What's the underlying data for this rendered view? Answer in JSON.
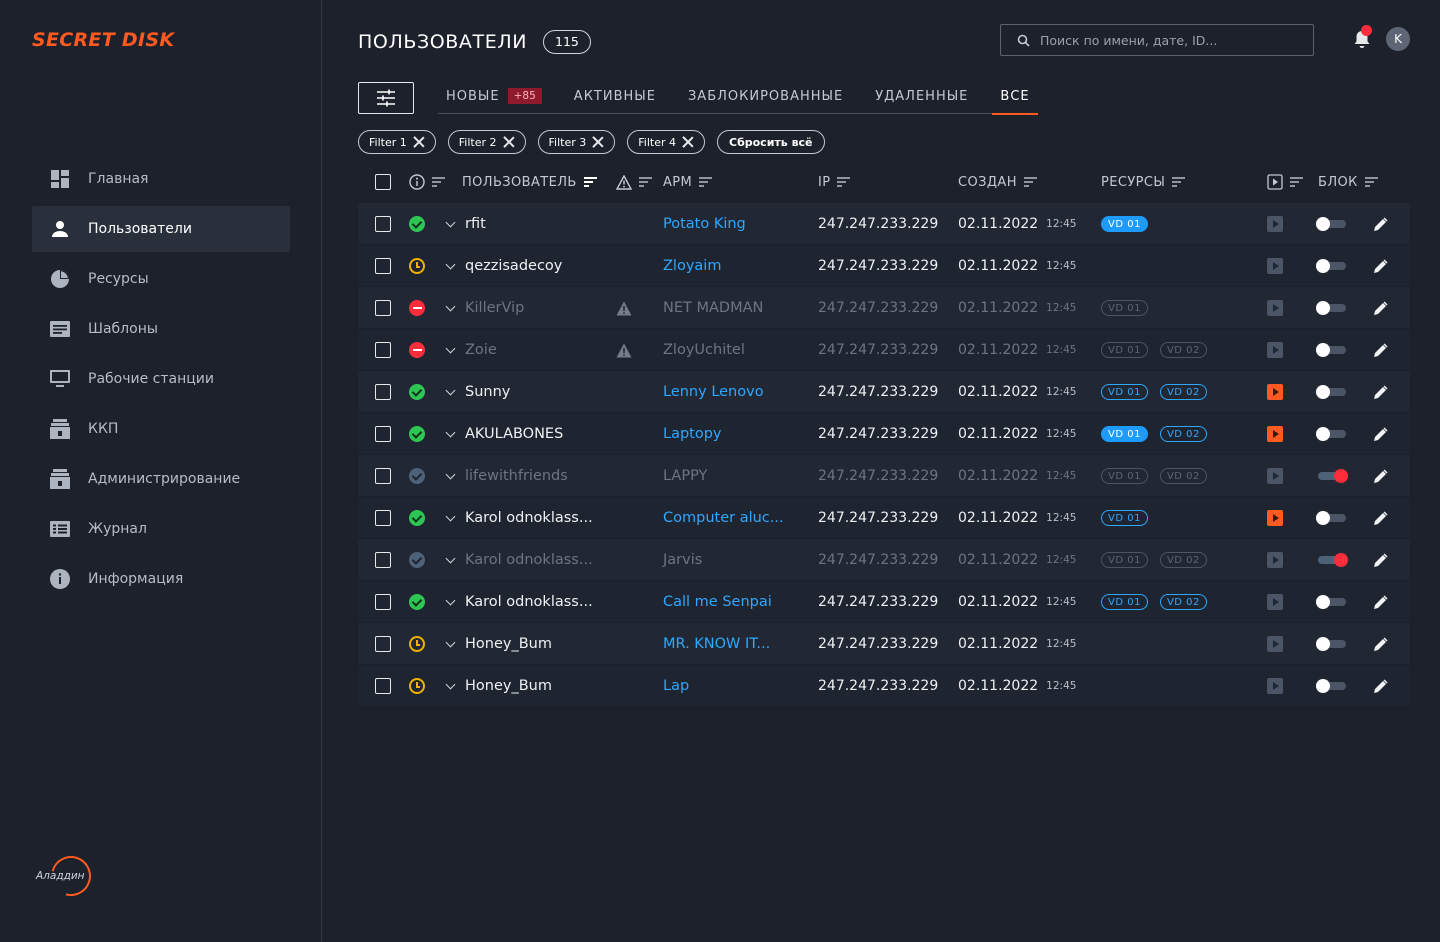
{
  "app": {
    "logo": "SECRET DISK",
    "brand": "Аладдин"
  },
  "sidebar": {
    "items": [
      {
        "label": "Главная",
        "icon": "dashboard-icon",
        "active": false
      },
      {
        "label": "Пользователи",
        "icon": "user-icon",
        "active": true
      },
      {
        "label": "Ресурсы",
        "icon": "pie-chart-icon",
        "active": false
      },
      {
        "label": "Шаблоны",
        "icon": "template-icon",
        "active": false
      },
      {
        "label": "Рабочие станции",
        "icon": "monitor-icon",
        "active": false
      },
      {
        "label": "ККП",
        "icon": "lock-box-icon",
        "active": false
      },
      {
        "label": "Администрирование",
        "icon": "admin-lock-icon",
        "active": false
      },
      {
        "label": "Журнал",
        "icon": "journal-icon",
        "active": false
      },
      {
        "label": "Информация",
        "icon": "info-icon",
        "active": false
      }
    ]
  },
  "header": {
    "title": "ПОЛЬЗОВАТЕЛИ",
    "count": "115",
    "search_placeholder": "Поиск по имени, дате, ID...",
    "avatar_initial": "K"
  },
  "tabs": [
    {
      "label": "НОВЫЕ",
      "badge": "+85",
      "active": false
    },
    {
      "label": "АКТИВНЫЕ",
      "badge": "",
      "active": false
    },
    {
      "label": "ЗАБЛОКИРОВАННЫЕ",
      "badge": "",
      "active": false
    },
    {
      "label": "УДАЛЕННЫЕ",
      "badge": "",
      "active": false
    },
    {
      "label": "ВСЕ",
      "badge": "",
      "active": true
    }
  ],
  "filters": [
    "Filter 1",
    "Filter 2",
    "Filter 3",
    "Filter 4"
  ],
  "reset_label": "Сбросить всё",
  "columns": {
    "user": "ПОЛЬЗОВАТЕЛЬ",
    "arm": "АРМ",
    "ip": "IP",
    "created": "СОЗДАН",
    "resources": "РЕСУРСЫ",
    "block": "БЛОК"
  },
  "colors": {
    "accent": "#ff5a1f",
    "link": "#2ea7ff",
    "ok": "#2dc653",
    "danger": "#ff2d3c",
    "warn": "#f0b100"
  },
  "rows": [
    {
      "status": "ok",
      "name": "rfit",
      "warn": false,
      "arm": "Potato King",
      "ip": "247.247.233.229",
      "date": "02.11.2022",
      "time": "12:45",
      "vd": [
        {
          "label": "VD 01",
          "fill": true
        }
      ],
      "play": false,
      "blocked": false,
      "dim": false
    },
    {
      "status": "wait",
      "name": "qezzisadecoy",
      "warn": false,
      "arm": "Zloyaim",
      "ip": "247.247.233.229",
      "date": "02.11.2022",
      "time": "12:45",
      "vd": [],
      "play": false,
      "blocked": false,
      "dim": false
    },
    {
      "status": "block",
      "name": "KillerVip",
      "warn": true,
      "arm": "NET MADMAN",
      "ip": "247.247.233.229",
      "date": "02.11.2022",
      "time": "12:45",
      "vd": [
        {
          "label": "VD 01",
          "fill": false
        }
      ],
      "play": false,
      "blocked": false,
      "dim": true
    },
    {
      "status": "block",
      "name": "Zoie",
      "warn": true,
      "arm": "ZloyUchitel",
      "ip": "247.247.233.229",
      "date": "02.11.2022",
      "time": "12:45",
      "vd": [
        {
          "label": "VD 01",
          "fill": false
        },
        {
          "label": "VD 02",
          "fill": false
        }
      ],
      "play": false,
      "blocked": false,
      "dim": true
    },
    {
      "status": "ok",
      "name": "Sunny",
      "warn": false,
      "arm": "Lenny Lenovo",
      "ip": "247.247.233.229",
      "date": "02.11.2022",
      "time": "12:45",
      "vd": [
        {
          "label": "VD 01",
          "fill": false
        },
        {
          "label": "VD 02",
          "fill": false
        }
      ],
      "play": true,
      "blocked": false,
      "dim": false
    },
    {
      "status": "ok",
      "name": "AKULABONES",
      "warn": false,
      "arm": "Laptopy",
      "ip": "247.247.233.229",
      "date": "02.11.2022",
      "time": "12:45",
      "vd": [
        {
          "label": "VD 01",
          "fill": true
        },
        {
          "label": "VD 02",
          "fill": false
        }
      ],
      "play": true,
      "blocked": false,
      "dim": false
    },
    {
      "status": "dim",
      "name": "lifewithfriends",
      "warn": false,
      "arm": "LAPPY",
      "ip": "247.247.233.229",
      "date": "02.11.2022",
      "time": "12:45",
      "vd": [
        {
          "label": "VD 01",
          "fill": false
        },
        {
          "label": "VD 02",
          "fill": false
        }
      ],
      "play": false,
      "blocked": true,
      "dim": true
    },
    {
      "status": "ok",
      "name": "Karol odnoklass...",
      "warn": false,
      "arm": "Computer aluc...",
      "ip": "247.247.233.229",
      "date": "02.11.2022",
      "time": "12:45",
      "vd": [
        {
          "label": "VD 01",
          "fill": false
        }
      ],
      "play": true,
      "blocked": false,
      "dim": false
    },
    {
      "status": "dim",
      "name": "Karol odnoklass...",
      "warn": false,
      "arm": "Jarvis",
      "ip": "247.247.233.229",
      "date": "02.11.2022",
      "time": "12:45",
      "vd": [
        {
          "label": "VD 01",
          "fill": false
        },
        {
          "label": "VD 02",
          "fill": false
        }
      ],
      "play": false,
      "blocked": true,
      "dim": true
    },
    {
      "status": "ok",
      "name": "Karol odnoklass...",
      "warn": false,
      "arm": "Call me Senpai",
      "ip": "247.247.233.229",
      "date": "02.11.2022",
      "time": "12:45",
      "vd": [
        {
          "label": "VD 01",
          "fill": false
        },
        {
          "label": "VD 02",
          "fill": false
        }
      ],
      "play": false,
      "blocked": false,
      "dim": false
    },
    {
      "status": "wait",
      "name": "Honey_Bum",
      "warn": false,
      "arm": "MR. KNOW IT...",
      "ip": "247.247.233.229",
      "date": "02.11.2022",
      "time": "12:45",
      "vd": [],
      "play": false,
      "blocked": false,
      "dim": false
    },
    {
      "status": "wait",
      "name": "Honey_Bum",
      "warn": false,
      "arm": "Lap",
      "ip": "247.247.233.229",
      "date": "02.11.2022",
      "time": "12:45",
      "vd": [],
      "play": false,
      "blocked": false,
      "dim": false
    }
  ]
}
